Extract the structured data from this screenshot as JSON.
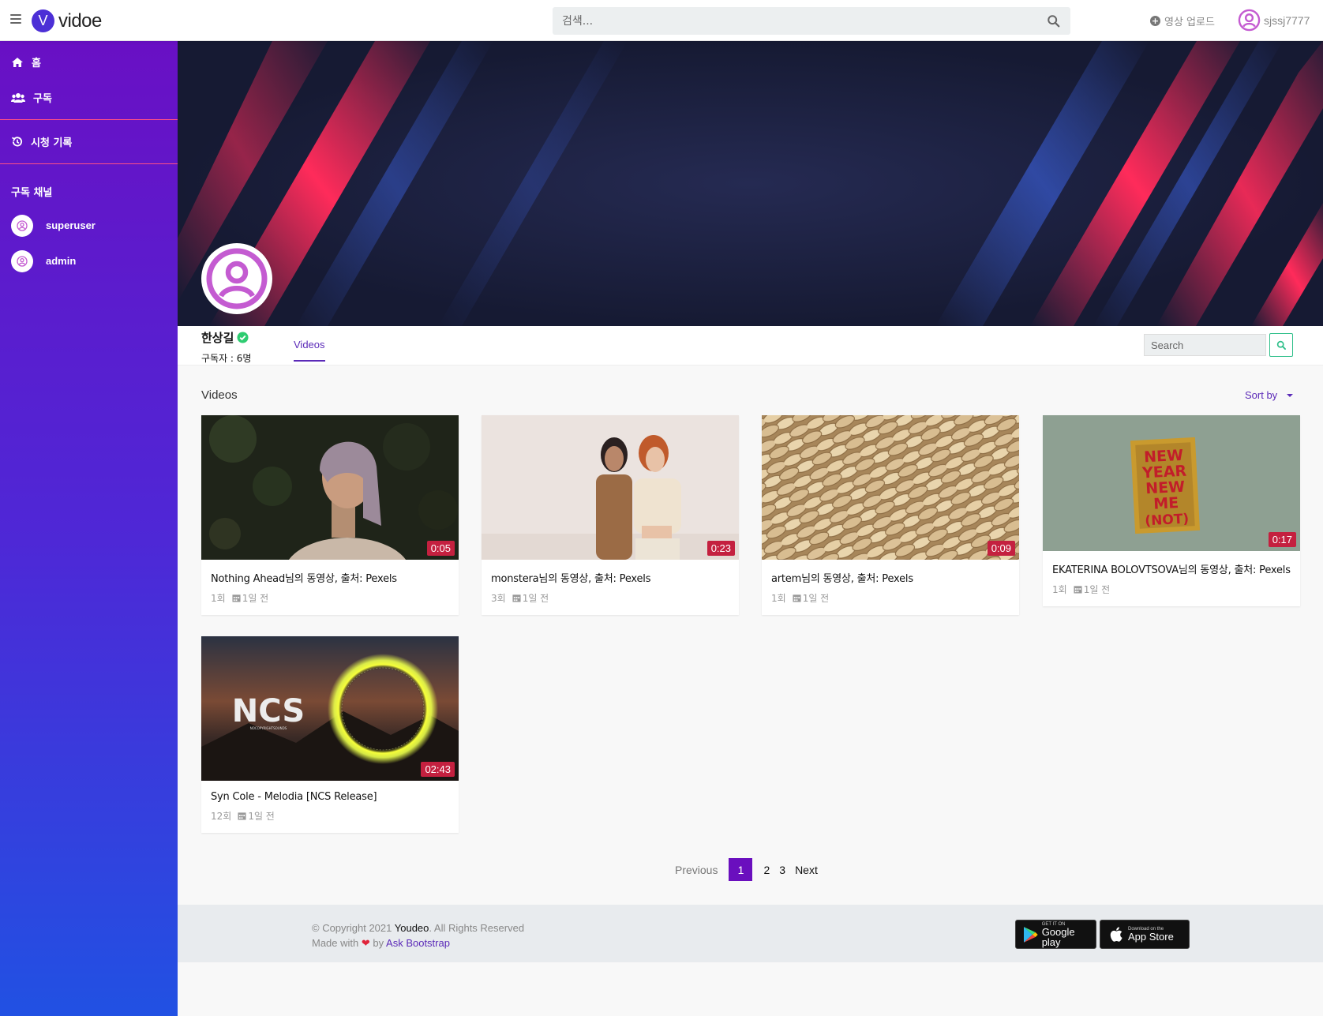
{
  "header": {
    "logo_letter": "V",
    "logo_text": "vidoe",
    "search_placeholder": "검색...",
    "upload_label": "영상 업로드",
    "username": "sjssj7777"
  },
  "sidebar": {
    "nav": [
      {
        "label": "홈",
        "icon": "home-icon"
      },
      {
        "label": "구독",
        "icon": "users-icon"
      },
      {
        "label": "시청 기록",
        "icon": "history-icon"
      }
    ],
    "subscriptions_heading": "구독 채널",
    "channels": [
      {
        "name": "superuser"
      },
      {
        "name": "admin"
      }
    ]
  },
  "channel": {
    "name": "한상길",
    "subscribers": "구독자 : 6명",
    "tab_label": "Videos",
    "search_placeholder": "Search"
  },
  "content": {
    "section_title": "Videos",
    "sort_label": "Sort by",
    "videos": [
      {
        "title": "Nothing Ahead님의 동영상, 출처: Pexels",
        "views": "1회",
        "date": "1일 전",
        "duration": "0:05"
      },
      {
        "title": "monstera님의 동영상, 출처: Pexels",
        "views": "3회",
        "date": "1일 전",
        "duration": "0:23"
      },
      {
        "title": "artem님의 동영상, 출처: Pexels",
        "views": "1회",
        "date": "1일 전",
        "duration": "0:09"
      },
      {
        "title": "EKATERINA BOLOVTSOVA님의 동영상, 출처: Pexels",
        "views": "1회",
        "date": "1일 전",
        "duration": "0:17"
      },
      {
        "title": "Syn Cole - Melodia [NCS Release]",
        "views": "12회",
        "date": "1일 전",
        "duration": "02:43"
      }
    ],
    "thumb_texts": {
      "newyear": [
        "NEW",
        "YEAR",
        "NEW",
        "ME",
        "(NOT)"
      ],
      "ncs": "NCS",
      "ncs_sub": "NOCOPYRIGHTSOUNDS"
    }
  },
  "pagination": {
    "previous": "Previous",
    "pages": [
      "1",
      "2",
      "3"
    ],
    "current": "1",
    "next": "Next"
  },
  "footer": {
    "copyright_prefix": "© Copyright 2021 ",
    "brand": "Youdeo",
    "copyright_suffix": ". All Rights Reserved",
    "made_with": "Made with ",
    "by": " by ",
    "author": "Ask Bootstrap",
    "google_small": "GET IT ON",
    "google_big": "Google play",
    "apple_small": "Download on the",
    "apple_big": "App Store"
  },
  "colors": {
    "sidebar_top": "#6910c4",
    "sidebar_bottom": "#2151e3",
    "accent": "#5b2ab8",
    "duration_badge": "#c4203f",
    "avatar_pink": "#c45bd1"
  }
}
